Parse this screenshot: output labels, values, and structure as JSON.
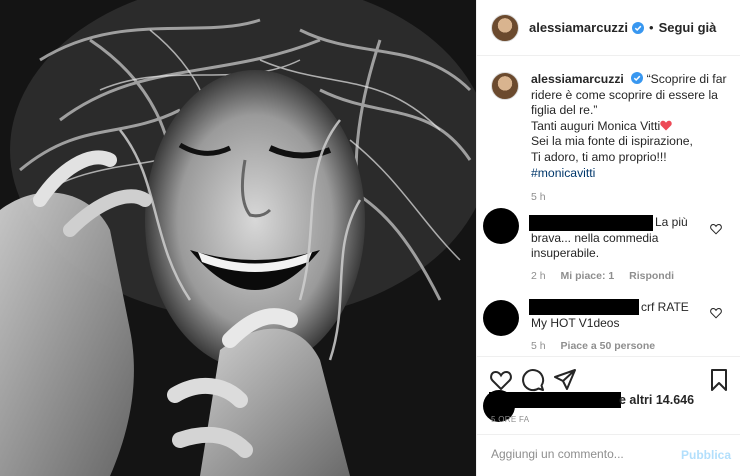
{
  "post": {
    "username": "alessiamarcuzzi",
    "follow_label": "Segui già",
    "separator": "•"
  },
  "caption": {
    "username": "alessiamarcuzzi",
    "line1": "“Scoprire di far ridere è come scoprire di essere la figlia del re.”",
    "line2": "Tanti auguri Monica Vitti",
    "line3": "Sei la mia fonte di ispirazione,",
    "line4": "Ti adoro, ti amo proprio!!!",
    "hashtag": "#monicavitti",
    "time": "5 h"
  },
  "comments": [
    {
      "text": "La più brava... nella commedia insuperabile.",
      "time": "2 h",
      "likes": "Mi piace: 1",
      "reply": "Rispondi"
    },
    {
      "text": "crf RATE My HOT V1deos",
      "time": "5 h",
      "likes": "Piace a 50 persone"
    }
  ],
  "likes": {
    "text": "e altri 14.646"
  },
  "date": "5 ORE FA",
  "comment_box": {
    "placeholder": "Aggiungi un commento...",
    "publish_label": "Pubblica"
  },
  "colors": {
    "verified_blue": "#3897f0",
    "heart_red": "#ed4956",
    "hashtag_blue": "#00376b",
    "publish_disabled": "#b2dffc"
  }
}
